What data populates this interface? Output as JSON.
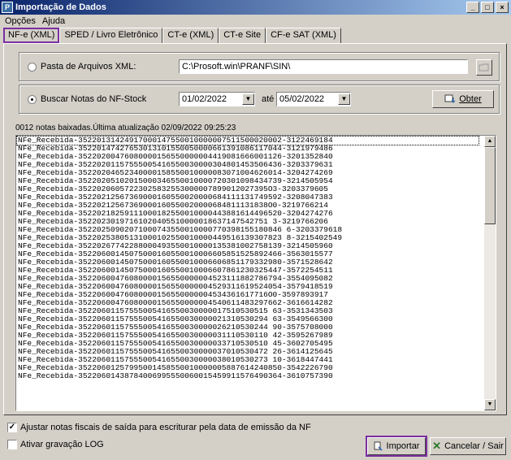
{
  "window": {
    "title": "Importação de Dados",
    "minimize": "_",
    "maximize": "□",
    "close": "×"
  },
  "menu": [
    {
      "label": "Opções"
    },
    {
      "label": "Ajuda"
    }
  ],
  "tabs": [
    {
      "label": "NF-e (XML)"
    },
    {
      "label": "SPED / Livro Eletrônico"
    },
    {
      "label": "CT-e (XML)"
    },
    {
      "label": "CT-e Site"
    },
    {
      "label": "CF-e SAT (XML)"
    }
  ],
  "source_folder": {
    "label": "Pasta de Arquivos XML:",
    "value": "C:\\Prosoft.win\\PRANF\\SIN\\"
  },
  "stock": {
    "label": "Buscar Notas do NF-Stock",
    "date_from": "01/02/2022",
    "separator": "até",
    "date_to": "05/02/2022",
    "button": "Obter"
  },
  "status": "0012 notas baixadas.Última atualização 02/09/2022 09:25:23",
  "files": [
    "NFe_Recebida-35220131424917000147550010000007511500020002-3122469184",
    "NFe_Recebida-35220147427653013101550050000661391086117044-3121979486",
    "NFe_Recebida-35220200476080000156550000004419081666001126-3201352840",
    "NFe_Recebida-35220201157555005416550030000304801453506436-3203379631",
    "NFe_Recebida-35220204652340000158550010000083071004626014-3204274269",
    "NFe_Recebida-35220205102015000346550010000720301098434739-3214505954",
    "NFe_Recebida-35220206057223025832553000007899012027395O3-3203379605",
    "NFe_Recebida-35220212567369000160550020000684111131749592-3208047383",
    "NFe_Recebida-35220212567369000160550020000684811131838O0-3219766214",
    "NFe_Recebida-35220218259111000182550010000443881614496520-3204274276",
    "NFe_Recebida-35220230197161020405510000018637147542751 3-3219766206",
    "NFe_Recebida-35220250902071000743550010000770398155180846 6-3203379618",
    "NFe_Recebida-35220253805131000102550010000449516139307823 8-3215402549",
    "NFe_Recebida-35220267742288000493550010000135381002758139-3214505960",
    "NFe_Recebida-35220600145075000160550010006605851525892466-3563015577",
    "NFe_Recebida-35220600145075000160550010006606851179332980-3571528642",
    "NFe_Recebida-35220600145075000160550010006607861230325447-3572254511",
    "NFe_Recebida-35220600476080000156550000004523111882786794-3554095082",
    "NFe_Recebida-35220600476080000156550000004529311619524054-3579418519",
    "NFe_Recebida-35220600476080000156550000004534361617716O0-3597893917",
    "NFe_Recebida-35220600476080000156550000004540611483297662-3616614282",
    "NFe_Recebida-35220601157555005416550030000017510530515 63-3531343503",
    "NFe_Recebida-35220601157555005416550030000021310530294 63-3549566300",
    "NFe_Recebida-35220601157555005416550030000026210530244 90-3575708000",
    "NFe_Recebida-35220601157555005416550030000031110530110 42-3595267989",
    "NFe_Recebida-35220601157555005416550030000033710530510 45-3602705495",
    "NFe_Recebida-35220601157555005416550030000037010530472 26-3614125645",
    "NFe_Recebida-35220601157555005416550030000038010530273 10-3618447441",
    "NFe_Recebida-35220601257995001458550010000005887614240850-3542226790",
    "NFe_Recebida-35220601438784006995550060015459911576490364-3610757390"
  ],
  "options": {
    "adjust_label": "Ajustar notas fiscais de saída para escriturar pela data de emissão da NF",
    "adjust_checked": "✓",
    "log_label": "Ativar gravação LOG"
  },
  "actions": {
    "import": "Importar",
    "cancel": "Cancelar / Sair"
  }
}
